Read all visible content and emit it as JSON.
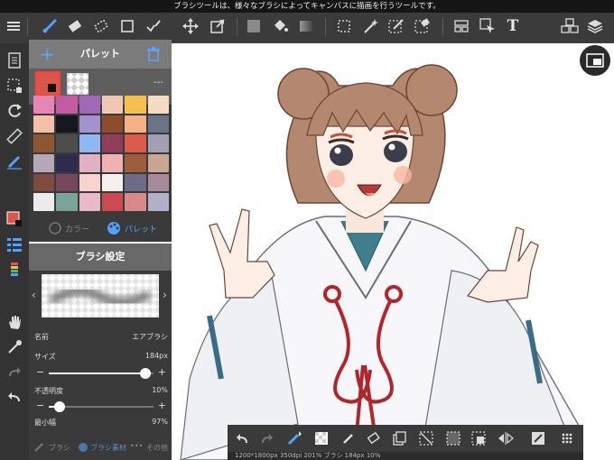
{
  "app": {
    "hint": "ブラシツールは、様々なブラシによってキャンバスに描画を行うツールです。",
    "status": "1200*1800px 350dpi 201% ブラシ 184px 10%"
  },
  "top_toolbar": {
    "icons": [
      "menu-icon",
      "brush-icon",
      "eraser-icon",
      "dotted-eraser-icon",
      "rectangle-icon",
      "check-pen-icon",
      "move-icon",
      "transform-icon",
      "fill-color-icon",
      "bucket-icon",
      "gradient-icon",
      "lasso-select-icon",
      "magic-wand-icon",
      "select-pen-icon",
      "select-eraser-icon",
      "layout-icon",
      "cursor-select-icon",
      "text-icon",
      "materials-icon",
      "layers-icon"
    ]
  },
  "palette": {
    "title": "パレット",
    "empty_label": "---",
    "tab_color": "カラー",
    "tab_palette": "パレット",
    "main_color": "#d9564a",
    "colors": [
      "#e686b5",
      "#c25aa4",
      "#a069b8",
      "#f1c6b3",
      "#f5c14e",
      "#f2dcc4",
      "#f4c0a7",
      "#16161e",
      "#a391d0",
      "#8e4c2a",
      "#f5b083",
      "#6b7487",
      "#8c5832",
      "#4d4d4f",
      "#8fb7f0",
      "#8e3e58",
      "#de5a4b",
      "#a2a0b4",
      "#b6a8b6",
      "#302c50",
      "#e2b0c3",
      "#f0b2b0",
      "#9e5e3c",
      "#cba593",
      "#7e4c3c",
      "#76485e",
      "#f8d2cd",
      "#f5f0ee",
      "#6a6d85",
      "#a88b9a",
      "#ececec",
      "#7aa39a",
      "#e8b9c6",
      "#cc4b52",
      "#d68a8a",
      "#b0b0c8"
    ]
  },
  "brush_settings": {
    "title": "ブラシ設定",
    "name_label": "名前",
    "name_value": "エアブラシ",
    "size_label": "サイズ",
    "size_value": "184px",
    "size_fraction": 0.92,
    "opacity_label": "不透明度",
    "opacity_value": "10%",
    "opacity_fraction": 0.1,
    "min_width_label": "最小幅",
    "min_width_value": "97%",
    "foot_brush": "ブラシ",
    "foot_material": "ブラシ素材",
    "foot_more": "•••",
    "foot_other": "その他"
  }
}
